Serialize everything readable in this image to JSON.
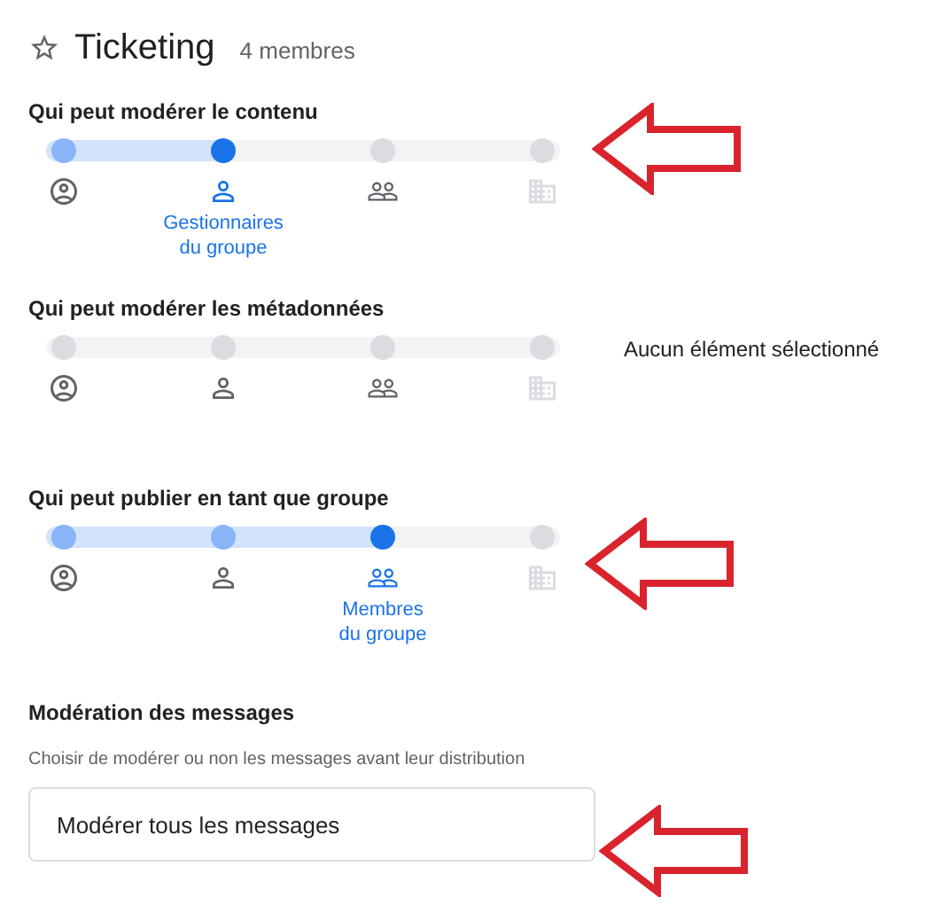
{
  "header": {
    "title": "Ticketing",
    "members": "4 membres",
    "starred": false
  },
  "sliders": [
    {
      "label": "Qui peut modérer le contenu",
      "stops": [
        {
          "kind": "account",
          "selected": false,
          "disabled": false
        },
        {
          "kind": "person",
          "selected": true,
          "disabled": false,
          "caption": "Gestionnaires\ndu groupe"
        },
        {
          "kind": "group",
          "selected": false,
          "disabled": false
        },
        {
          "kind": "building",
          "selected": false,
          "disabled": true
        }
      ]
    },
    {
      "label": "Qui peut modérer les métadonnées",
      "note": "Aucun élément sélectionné",
      "stops": [
        {
          "kind": "account",
          "selected": false,
          "disabled": false
        },
        {
          "kind": "person",
          "selected": false,
          "disabled": false
        },
        {
          "kind": "group",
          "selected": false,
          "disabled": false
        },
        {
          "kind": "building",
          "selected": false,
          "disabled": true
        }
      ]
    },
    {
      "label": "Qui peut publier en tant que groupe",
      "stops": [
        {
          "kind": "account",
          "selected": false,
          "disabled": false
        },
        {
          "kind": "person",
          "selected": false,
          "disabled": false
        },
        {
          "kind": "group",
          "selected": true,
          "disabled": false,
          "caption": "Membres\ndu groupe"
        },
        {
          "kind": "building",
          "selected": false,
          "disabled": true
        }
      ]
    }
  ],
  "moderation": {
    "title": "Modération des messages",
    "description": "Choisir de modérer ou non les messages avant leur distribution",
    "value": "Modérer tous les messages"
  }
}
